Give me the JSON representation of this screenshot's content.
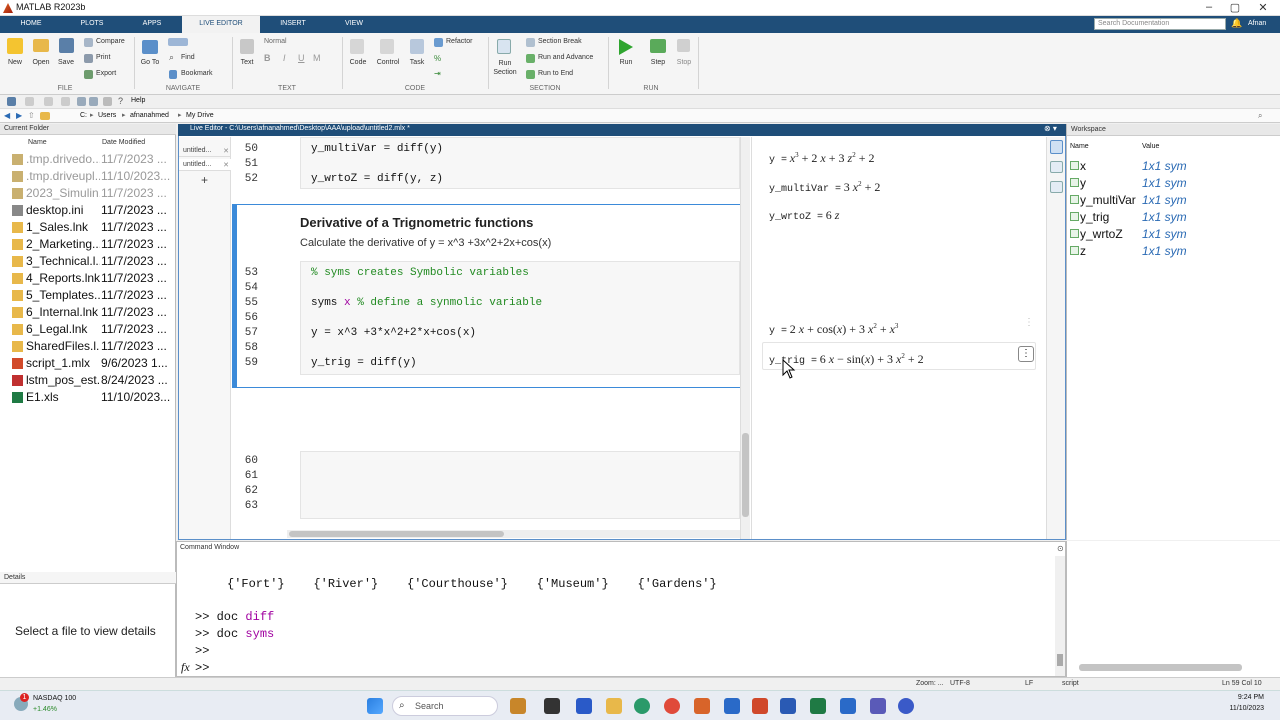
{
  "window": {
    "title": "MATLAB R2023b",
    "user": "Afnan"
  },
  "tabs": [
    "HOME",
    "PLOTS",
    "APPS",
    "LIVE EDITOR",
    "INSERT",
    "VIEW"
  ],
  "active_tab": "LIVE EDITOR",
  "search": {
    "placeholder": "Search Documentation"
  },
  "ribbon": {
    "file": {
      "section": "FILE",
      "new": "New",
      "open": "Open",
      "save": "Save",
      "compare": "Compare",
      "print": "Print",
      "export": "Export"
    },
    "navigate": {
      "section": "NAVIGATE",
      "goto": "Go To",
      "find": "Find",
      "bookmark": "Bookmark"
    },
    "text": {
      "section": "TEXT",
      "text": "Text",
      "style": "Normal"
    },
    "code": {
      "section": "CODE",
      "code": "Code",
      "control": "Control",
      "task": "Task",
      "refactor": "Refactor"
    },
    "section": {
      "section": "SECTION",
      "run_section": "Run Section",
      "section_break": "Section Break",
      "run_advance": "Run and Advance",
      "run_to_end": "Run to End"
    },
    "run": {
      "section": "RUN",
      "run": "Run",
      "step": "Step",
      "stop": "Stop"
    }
  },
  "quick_access": {
    "help": "Help"
  },
  "address": [
    "C:",
    "Users",
    "afnanahmed",
    "My Drive"
  ],
  "current_folder": {
    "title": "Current Folder",
    "col_name": "Name",
    "col_date": "Date Modified",
    "files": [
      {
        "name": ".tmp.drivedo...",
        "date": "11/7/2023 ..."
      },
      {
        "name": ".tmp.driveupl...",
        "date": "11/10/2023..."
      },
      {
        "name": "2023_Simulin...",
        "date": "11/7/2023 ..."
      },
      {
        "name": "desktop.ini",
        "date": "11/7/2023 ..."
      },
      {
        "name": "1_Sales.lnk",
        "date": "11/7/2023 ..."
      },
      {
        "name": "2_Marketing...",
        "date": "11/7/2023 ..."
      },
      {
        "name": "3_Technical.l...",
        "date": "11/7/2023 ..."
      },
      {
        "name": "4_Reports.lnk",
        "date": "11/7/2023 ..."
      },
      {
        "name": "5_Templates....",
        "date": "11/7/2023 ..."
      },
      {
        "name": "6_Internal.lnk",
        "date": "11/7/2023 ..."
      },
      {
        "name": "6_Legal.lnk",
        "date": "11/7/2023 ..."
      },
      {
        "name": "SharedFiles.l...",
        "date": "11/7/2023 ..."
      },
      {
        "name": "script_1.mlx",
        "date": "9/6/2023 1..."
      },
      {
        "name": "lstm_pos_est...",
        "date": "8/24/2023 ..."
      },
      {
        "name": "E1.xls",
        "date": "11/10/2023..."
      }
    ]
  },
  "details": {
    "title": "Details",
    "message": "Select a file to view details"
  },
  "editor": {
    "title": "Live Editor - C:\\Users\\afnanahmed\\Desktop\\AAA\\upload\\untitled2.mlx *",
    "docs": [
      "untitled...",
      "untitled..."
    ],
    "add": "+",
    "lines_top": [
      {
        "n": "50",
        "code": "y_multiVar = diff(y)"
      },
      {
        "n": "51",
        "code": ""
      },
      {
        "n": "52",
        "code": "y_wrtoZ = diff(y, z)"
      }
    ],
    "heading": "Derivative of a Trignometric functions",
    "subtext": "Calculate the derivative of y = x^3 +3x^2+2x+cos(x)",
    "lines_mid": [
      {
        "n": "53",
        "code": "% syms creates Symbolic variables"
      },
      {
        "n": "54",
        "code": ""
      },
      {
        "n": "55",
        "code": "syms x % define a synmolic variable"
      },
      {
        "n": "56",
        "code": ""
      },
      {
        "n": "57",
        "code": "y = x^3 +3*x^2+2*x+cos(x)"
      },
      {
        "n": "58",
        "code": ""
      },
      {
        "n": "59",
        "code": "y_trig = diff(y)"
      }
    ],
    "lines_bottom": [
      {
        "n": "60"
      },
      {
        "n": "61"
      },
      {
        "n": "62"
      },
      {
        "n": "63"
      }
    ],
    "outputs": {
      "o1_lhs": "y =",
      "o2_lhs": "y_multiVar =",
      "o3_lhs": "y_wrtoZ =",
      "o4_lhs": "y =",
      "o5_lhs": "y_trig ="
    }
  },
  "workspace": {
    "title": "Workspace",
    "col_name": "Name",
    "col_value": "Value",
    "vars": [
      {
        "name": "x",
        "value": "1x1 sym"
      },
      {
        "name": "y",
        "value": "1x1 sym"
      },
      {
        "name": "y_multiVar",
        "value": "1x1 sym"
      },
      {
        "name": "y_trig",
        "value": "1x1 sym"
      },
      {
        "name": "y_wrtoZ",
        "value": "1x1 sym"
      },
      {
        "name": "z",
        "value": "1x1 sym"
      }
    ]
  },
  "command_window": {
    "title": "Command Window",
    "cell": "{'Fort'}    {'River'}    {'Courthouse'}    {'Museum'}    {'Gardens'}",
    "cmd1_prompt": ">> doc ",
    "cmd1_arg": "diff",
    "cmd2_prompt": ">> doc ",
    "cmd2_arg": "syms",
    "cmd3": ">>",
    "cmd4": ">>",
    "fx": "fx"
  },
  "statusbar": {
    "zoom": "Zoom: ...",
    "encoding": "UTF-8",
    "eol": "LF",
    "type": "script",
    "position": "Ln 59   Col 10"
  },
  "taskbar": {
    "stock": "NASDAQ 100",
    "change": "+1.46%",
    "search": "Search",
    "time": "9:24 PM",
    "date": "11/10/2023",
    "badge": "1"
  }
}
